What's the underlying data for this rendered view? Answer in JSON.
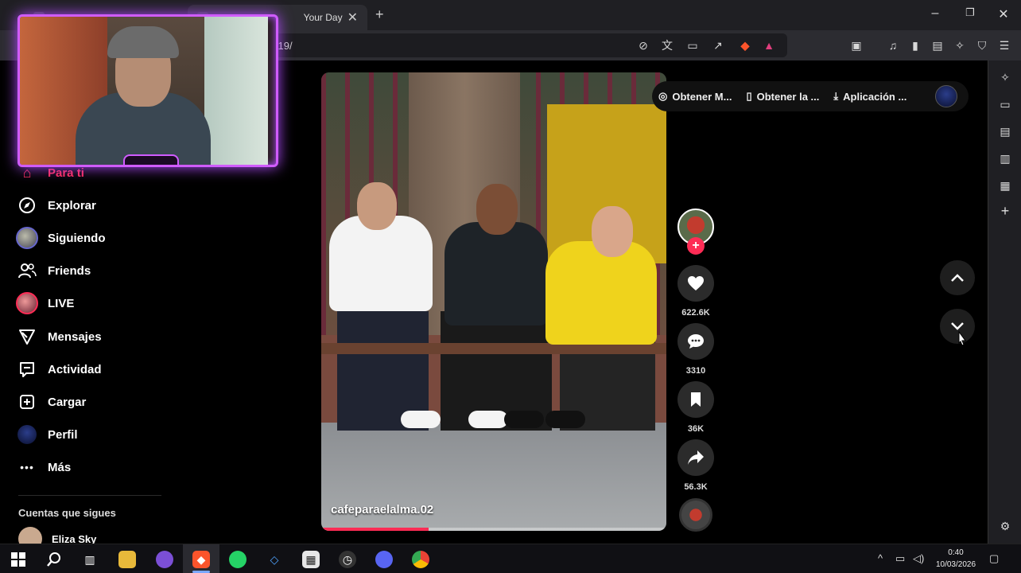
{
  "browser": {
    "tabs": [
      {
        "title": "",
        "active": false
      },
      {
        "title": "Your Day",
        "active": true
      }
    ],
    "url": "-419/",
    "colors": {
      "brave_orange": "#fb542b",
      "accent_pink": "#fe2c55"
    }
  },
  "nav": {
    "items": [
      {
        "label": "Para ti",
        "icon": "home-icon"
      },
      {
        "label": "Explorar",
        "icon": "compass-icon"
      },
      {
        "label": "Siguiendo",
        "icon": "avatar"
      },
      {
        "label": "Friends",
        "icon": "friends-icon"
      },
      {
        "label": "LIVE",
        "icon": "live-avatar"
      },
      {
        "label": "Mensajes",
        "icon": "send-icon"
      },
      {
        "label": "Actividad",
        "icon": "message-box-icon"
      },
      {
        "label": "Cargar",
        "icon": "plus-box-icon"
      },
      {
        "label": "Perfil",
        "icon": "profile-avatar"
      },
      {
        "label": "Más",
        "icon": "more-icon"
      }
    ],
    "following_title": "Cuentas que sigues",
    "following_users": [
      {
        "name": "Eliza Sky"
      }
    ]
  },
  "top_pills": {
    "items": [
      {
        "label": "Obtener M...",
        "icon": "coin-icon"
      },
      {
        "label": "Obtener la ...",
        "icon": "phone-icon"
      },
      {
        "label": "Aplicación ...",
        "icon": "download-icon"
      }
    ]
  },
  "video": {
    "username": "cafeparaelalma.02",
    "progress": 0.31
  },
  "actions": {
    "likes": "622.6K",
    "comments": "3310",
    "saves": "36K",
    "shares": "56.3K"
  },
  "taskbar": {
    "time": "0:40",
    "date": "10/03/2026"
  }
}
